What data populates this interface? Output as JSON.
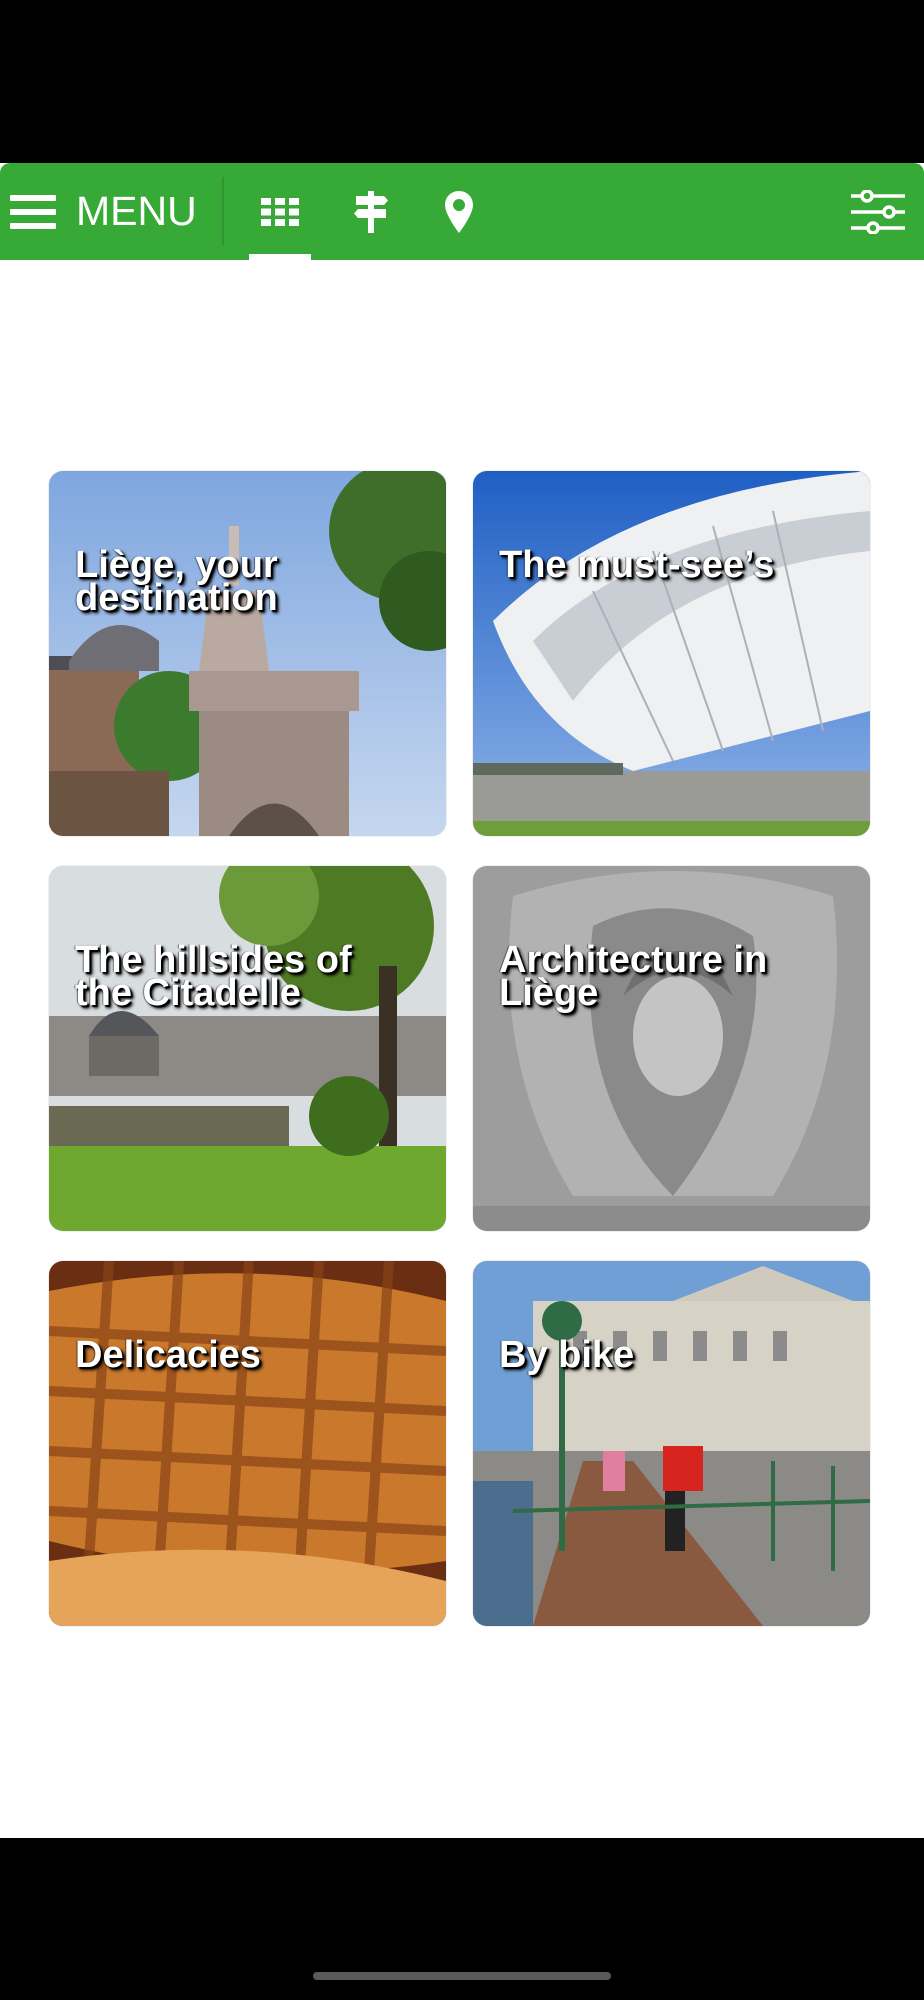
{
  "header": {
    "menu_label": "MENU",
    "icons": [
      "hamburger-icon",
      "grid-icon",
      "signpost-icon",
      "location-pin-icon",
      "filter-sliders-icon"
    ],
    "accent_color": "#37a937"
  },
  "tiles": [
    {
      "title": "Liège, your destination",
      "image": "fountain-monument-photo"
    },
    {
      "title": "The must-see’s",
      "image": "train-station-canopy-photo"
    },
    {
      "title": "The hillsides of the Citadelle",
      "image": "city-view-park-photo"
    },
    {
      "title": "Architecture in Liège",
      "image": "stone-face-relief-photo"
    },
    {
      "title": "Delicacies",
      "image": "waffles-photo"
    },
    {
      "title": "By bike",
      "image": "cyclists-riverside-photo"
    }
  ]
}
